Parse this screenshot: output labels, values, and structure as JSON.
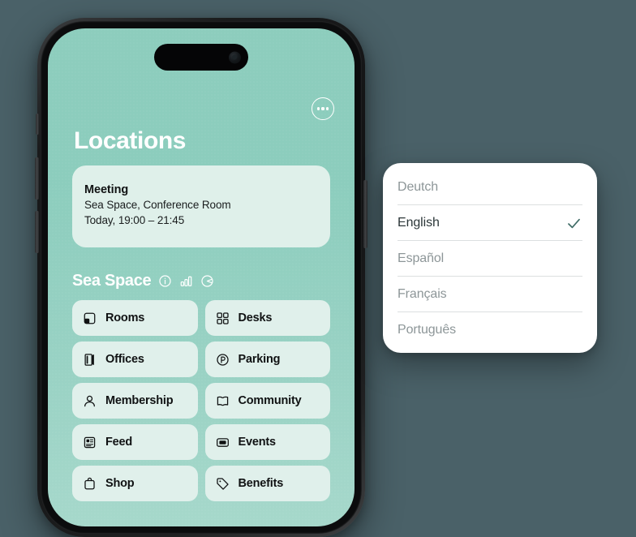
{
  "theme": {
    "page_background": "#4a6168",
    "screen_gradient_top": "#8dcdbd",
    "screen_gradient_bottom": "#a6d8cb",
    "card_background": "#dff0ea",
    "tile_background": "#e0f0eb",
    "title_color": "#ffffff",
    "menu_background": "#ffffff",
    "menu_text_inactive": "#8d9698",
    "menu_text_active": "#2c3739",
    "check_color": "#3f6b66"
  },
  "phone": {
    "more_button": {
      "icon": "ellipsis-icon",
      "label": "More options"
    },
    "dynamic_island": {
      "camera_icon": "front-camera-icon"
    },
    "side_buttons": [
      "mute-switch",
      "volume-up-button",
      "volume-down-button",
      "power-button"
    ]
  },
  "screen": {
    "page_title": "Locations",
    "meeting_card": {
      "title": "Meeting",
      "location": "Sea Space, Conference Room",
      "time": "Today, 19:00 – 21:45"
    },
    "section": {
      "title": "Sea Space",
      "icons": [
        {
          "name": "info-circle-icon"
        },
        {
          "name": "bar-chart-icon"
        },
        {
          "name": "gauge-icon"
        }
      ]
    },
    "tiles": [
      {
        "label": "Rooms",
        "icon": "rooms-icon"
      },
      {
        "label": "Desks",
        "icon": "desks-icon"
      },
      {
        "label": "Offices",
        "icon": "offices-door-icon"
      },
      {
        "label": "Parking",
        "icon": "parking-icon"
      },
      {
        "label": "Membership",
        "icon": "person-icon"
      },
      {
        "label": "Community",
        "icon": "open-book-icon"
      },
      {
        "label": "Feed",
        "icon": "feed-document-icon"
      },
      {
        "label": "Events",
        "icon": "events-ticket-icon"
      },
      {
        "label": "Shop",
        "icon": "shopping-bag-icon"
      },
      {
        "label": "Benefits",
        "icon": "tag-icon"
      }
    ]
  },
  "language_menu": {
    "options": [
      {
        "label": "Deutch",
        "selected": false
      },
      {
        "label": "English",
        "selected": true
      },
      {
        "label": "Español",
        "selected": false
      },
      {
        "label": "Français",
        "selected": false
      },
      {
        "label": "Português",
        "selected": false
      }
    ],
    "check_icon": "checkmark-icon"
  }
}
